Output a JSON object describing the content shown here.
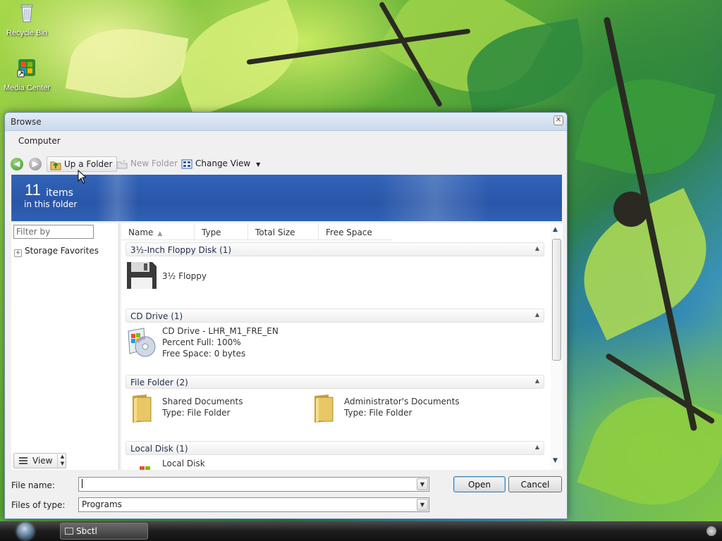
{
  "desktop": {
    "icons": [
      {
        "label": "Recycle Bin"
      },
      {
        "label": "Media Center"
      }
    ]
  },
  "dialog": {
    "title": "Browse",
    "breadcrumb": "Computer",
    "toolbar": {
      "up_folder": "Up a Folder",
      "new_folder": "New Folder",
      "change_view": "Change View"
    },
    "banner": {
      "count": "11",
      "count_unit": "items",
      "subtitle": "in this folder"
    },
    "filter_placeholder": "Filter by",
    "tree": {
      "storage_favorites": "Storage Favorites"
    },
    "view_button": "View",
    "columns": [
      "Name",
      "Type",
      "Total Size",
      "Free Space"
    ],
    "groups": [
      {
        "heading": "3½-Inch Floppy Disk (1)",
        "items": [
          {
            "lines": [
              "3½ Floppy"
            ]
          }
        ]
      },
      {
        "heading": "CD Drive (1)",
        "items": [
          {
            "lines": [
              "CD Drive - LHR_M1_FRE_EN",
              "Percent Full: 100%",
              "Free Space: 0 bytes"
            ]
          }
        ]
      },
      {
        "heading": "File Folder (2)",
        "items": [
          {
            "lines": [
              "Shared Documents",
              "Type: File Folder"
            ]
          },
          {
            "lines": [
              "Administrator's Documents",
              "Type: File Folder"
            ]
          }
        ]
      },
      {
        "heading": "Local Disk (1)",
        "items": [
          {
            "lines": [
              "Local Disk"
            ]
          }
        ]
      }
    ],
    "file_name_label": "File name:",
    "file_name_value": "",
    "files_of_type_label": "Files of type:",
    "files_of_type_value": "Programs",
    "open_button": "Open",
    "cancel_button": "Cancel"
  },
  "taskbar": {
    "task_label": "Sbctl"
  },
  "colors": {
    "banner_blue": "#2a56a8",
    "title_gradient": "#c9d9ec",
    "accent_button_border": "#3c7fb1"
  }
}
